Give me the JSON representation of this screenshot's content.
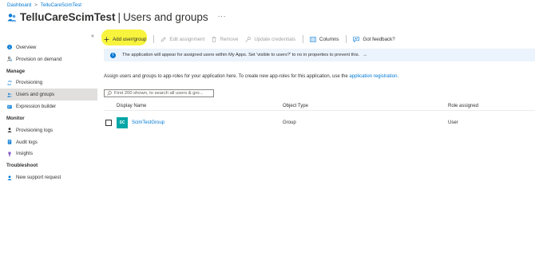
{
  "breadcrumb": {
    "items": [
      "Dashboard",
      "TelluCareScimTest"
    ],
    "separator": ">"
  },
  "header": {
    "app_name": "TelluCareScimTest",
    "divider": "|",
    "page_name": "Users and groups",
    "more_label": "···"
  },
  "sidebar": {
    "collapse_label": "«",
    "top_items": [
      {
        "label": "Overview",
        "icon": "info-icon"
      },
      {
        "label": "Provision on demand",
        "icon": "person-sync-icon"
      }
    ],
    "sections": [
      {
        "title": "Manage",
        "items": [
          {
            "label": "Provisioning",
            "icon": "provisioning-icon"
          },
          {
            "label": "Users and groups",
            "icon": "users-icon",
            "active": true
          },
          {
            "label": "Expression builder",
            "icon": "expression-builder-icon"
          }
        ]
      },
      {
        "title": "Monitor",
        "items": [
          {
            "label": "Provisioning logs",
            "icon": "person-log-icon"
          },
          {
            "label": "Audit logs",
            "icon": "audit-log-icon"
          },
          {
            "label": "Insights",
            "icon": "insights-icon"
          }
        ]
      },
      {
        "title": "Troubleshoot",
        "items": [
          {
            "label": "New support request",
            "icon": "support-person-icon"
          }
        ]
      }
    ]
  },
  "toolbar": {
    "add": "Add user/group",
    "edit": "Edit assignment",
    "remove": "Remove",
    "update": "Update credentials",
    "columns": "Columns",
    "feedback": "Got feedback?"
  },
  "info_bar": {
    "text": "The application will appear for assigned users within My Apps. Set 'visible to users?' to no in properties to prevent this.",
    "arrow": "→"
  },
  "description": {
    "text": "Assign users and groups to app-roles for your application here. To create new app-roles for this application, use the",
    "link": "application registration",
    "end": "."
  },
  "search": {
    "placeholder": "First 200 shown, to search all users & gro..."
  },
  "table": {
    "headers": [
      "Display Name",
      "Object Type",
      "Role assigned"
    ],
    "rows": [
      {
        "initials": "SC",
        "name": "ScimTestGroup",
        "type": "Group",
        "role": "User"
      }
    ]
  },
  "colors": {
    "accent": "#0078d4",
    "highlight": "#f7f21b",
    "avatar": "#00a6a6",
    "info_bg": "#ebf3fc",
    "active_nav": "#e1dfdd"
  }
}
